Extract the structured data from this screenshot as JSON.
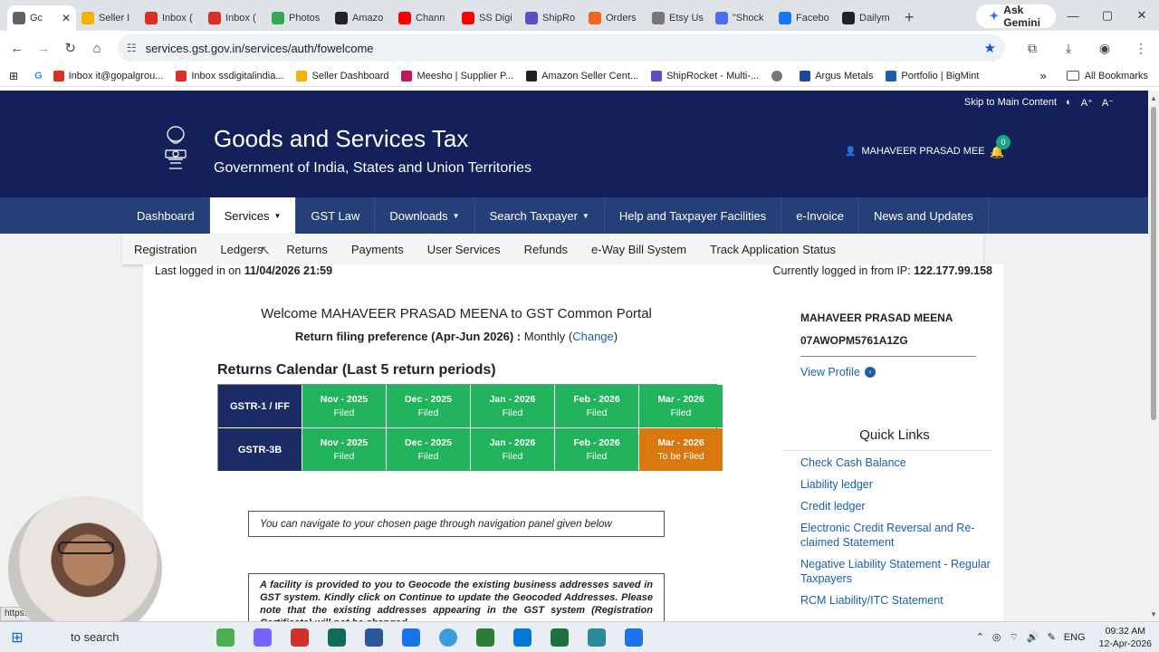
{
  "browser": {
    "tabs": [
      {
        "title": "Gc",
        "color": "#5f6368",
        "active": true
      },
      {
        "title": "Seller I",
        "color": "#f2b400"
      },
      {
        "title": "Inbox (",
        "color": "#d93025"
      },
      {
        "title": "Inbox (",
        "color": "#d93025"
      },
      {
        "title": "Photos",
        "color": "#34a853"
      },
      {
        "title": "Amazo",
        "color": "#222222"
      },
      {
        "title": "Chann",
        "color": "#ff0000"
      },
      {
        "title": "SS Digi",
        "color": "#ff0000"
      },
      {
        "title": "ShipRo",
        "color": "#5b4ec7"
      },
      {
        "title": "Orders",
        "color": "#f1641e"
      },
      {
        "title": "Etsy Us",
        "color": "#777777"
      },
      {
        "title": "\"Shock",
        "color": "#4a6cf7"
      },
      {
        "title": "Facebo",
        "color": "#1877f2"
      },
      {
        "title": "Dailym",
        "color": "#222222"
      }
    ],
    "gemini_label": "Ask Gemini",
    "url": "services.gst.gov.in/services/auth/fowelcome",
    "bookmarks": [
      {
        "label": "Inbox it@gopalgrou...",
        "color": "#d93025"
      },
      {
        "label": "Inbox ssdigitalindia...",
        "color": "#d93025"
      },
      {
        "label": "Seller Dashboard",
        "color": "#f2b400"
      },
      {
        "label": "Meesho | Supplier P...",
        "color": "#c2185b"
      },
      {
        "label": "Amazon Seller Cent...",
        "color": "#222222"
      },
      {
        "label": "ShipRocket - Multi-...",
        "color": "#5b4ec7"
      },
      {
        "label": "",
        "color": "#777777"
      },
      {
        "label": "Argus Metals",
        "color": "#1b4aa0"
      },
      {
        "label": "Portfolio | BigMint",
        "color": "#1b5fa8"
      }
    ],
    "all_bookmarks": "All Bookmarks"
  },
  "accessibility": {
    "skip": "Skip to Main Content",
    "increase": "A⁺",
    "decrease": "A⁻"
  },
  "header": {
    "title": "Goods and Services Tax",
    "subtitle": "Government of India, States and Union Territories",
    "user": "MAHAVEER PRASAD MEE",
    "notifications": "0"
  },
  "nav": [
    {
      "label": "Dashboard",
      "dropdown": false
    },
    {
      "label": "Services",
      "dropdown": true,
      "active": true
    },
    {
      "label": "GST Law",
      "dropdown": false
    },
    {
      "label": "Downloads",
      "dropdown": true
    },
    {
      "label": "Search Taxpayer",
      "dropdown": true
    },
    {
      "label": "Help and Taxpayer Facilities",
      "dropdown": false
    },
    {
      "label": "e-Invoice",
      "dropdown": false
    },
    {
      "label": "News and Updates",
      "dropdown": false
    }
  ],
  "subnav": [
    "Registration",
    "Ledgers",
    "Returns",
    "Payments",
    "User Services",
    "Refunds",
    "e-Way Bill System",
    "Track Application Status"
  ],
  "login": {
    "last_label": "Last logged in on",
    "last_value": "11/04/2026 21:59",
    "ip_label": "Currently logged in from IP:",
    "ip_value": "122.177.99.158"
  },
  "welcome": "Welcome MAHAVEER PRASAD MEENA to GST Common Portal",
  "preference": {
    "label": "Return filing preference (Apr-Jun 2026) :",
    "value": "Monthly",
    "change": "Change"
  },
  "calendar": {
    "title": "Returns Calendar (Last 5 return periods)",
    "rows": [
      {
        "form": "GSTR-1 / IFF",
        "cells": [
          {
            "period": "Nov - 2025",
            "status": "Filed"
          },
          {
            "period": "Dec - 2025",
            "status": "Filed"
          },
          {
            "period": "Jan - 2026",
            "status": "Filed"
          },
          {
            "period": "Feb - 2026",
            "status": "Filed"
          },
          {
            "period": "Mar - 2026",
            "status": "Filed"
          }
        ]
      },
      {
        "form": "GSTR-3B",
        "cells": [
          {
            "period": "Nov - 2025",
            "status": "Filed"
          },
          {
            "period": "Dec - 2025",
            "status": "Filed"
          },
          {
            "period": "Jan - 2026",
            "status": "Filed"
          },
          {
            "period": "Feb - 2026",
            "status": "Filed"
          },
          {
            "period": "Mar - 2026",
            "status": "To be Filed"
          }
        ]
      }
    ],
    "colors": {
      "filed": "#22b45c",
      "due": "#d9780e",
      "head": "#1b2b66"
    }
  },
  "nav_note": "You can navigate to your chosen page through navigation panel given below",
  "geocode_note": "A facility is provided to you to Geocode the existing business addresses saved in GST system. Kindly click on Continue to update the Geocoded Addresses. Please note that the existing addresses appearing in the GST system (Registration Certificate) will not be changed.",
  "profile": {
    "name": "MAHAVEER PRASAD MEENA",
    "gstin": "07AWOPM5761A1ZG",
    "view_profile": "View Profile"
  },
  "quick_links": {
    "title": "Quick Links",
    "items": [
      "Check Cash Balance",
      "Liability ledger",
      "Credit ledger",
      "Electronic Credit Reversal and Re-claimed Statement",
      "Negative Liability Statement - Regular Taxpayers",
      "RCM Liability/ITC Statement"
    ]
  },
  "status_url": "https:",
  "taskbar": {
    "search": "to search",
    "lang": "ENG",
    "time": "09:32 AM",
    "date": "12-Apr-2026",
    "apps": [
      "#4caf50",
      "#7b61ff",
      "#d32f2f",
      "#0f6b5c",
      "#2b5797",
      "#1a73e8",
      "#3b9ddd",
      "#2e7d32",
      "#0078d4",
      "#1d6f42",
      "#2b8a9c",
      "#1a73e8"
    ]
  }
}
